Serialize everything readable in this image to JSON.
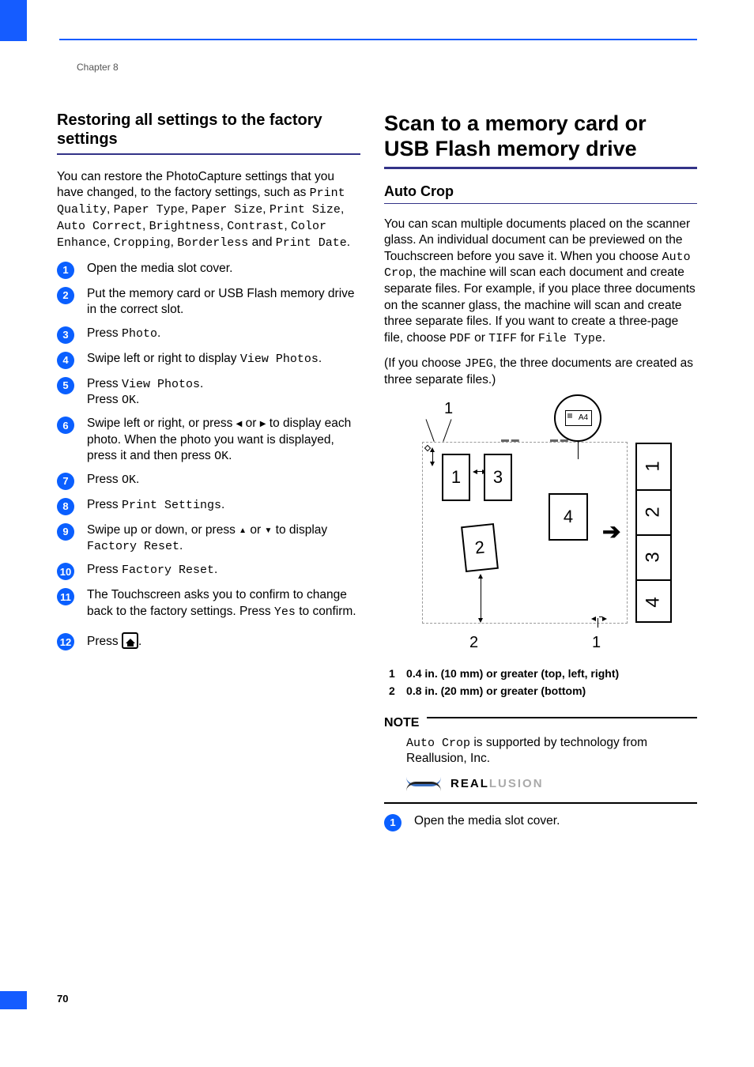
{
  "chapter": "Chapter 8",
  "page_number": "70",
  "left": {
    "heading": "Restoring all settings to the factory settings",
    "intro1": "You can restore the PhotoCapture settings that you have changed, to the factory settings, such as ",
    "mono_settings": [
      "Print Quality",
      "Paper Type",
      "Paper Size",
      "Print Size",
      "Auto Correct",
      "Brightness",
      "Contrast",
      "Color Enhance",
      "Cropping",
      "Borderless"
    ],
    "intro_and": " and ",
    "mono_last": "Print Date",
    "intro_period": ".",
    "steps": [
      {
        "n": "1",
        "body": "Open the media slot cover."
      },
      {
        "n": "2",
        "body": "Put the memory card or USB Flash memory drive in the correct slot."
      },
      {
        "n": "3",
        "pre": "Press ",
        "mono": "Photo",
        "post": "."
      },
      {
        "n": "4",
        "pre": "Swipe left or right to display ",
        "mono": "View Photos",
        "post": "."
      },
      {
        "n": "5",
        "line1_pre": "Press ",
        "line1_mono": "View Photos",
        "line1_post": ".",
        "line2_pre": "Press ",
        "line2_mono": "OK",
        "line2_post": "."
      },
      {
        "n": "6",
        "pre": "Swipe left or right, or press ",
        "mid": " or ",
        "post": " to display each photo. When the photo you want is displayed, press it and then press ",
        "mono": "OK",
        "post2": "."
      },
      {
        "n": "7",
        "pre": "Press ",
        "mono": "OK",
        "post": "."
      },
      {
        "n": "8",
        "pre": "Press ",
        "mono": "Print Settings",
        "post": "."
      },
      {
        "n": "9",
        "pre": "Swipe up or down, or press ",
        "mid": " or ",
        "post": " to display ",
        "mono": "Factory Reset",
        "post2": "."
      },
      {
        "n": "10",
        "pre": "Press ",
        "mono": "Factory Reset",
        "post": "."
      },
      {
        "n": "11",
        "pre": "The Touchscreen asks you to confirm to change back to the factory settings. Press ",
        "mono": "Yes",
        "post": " to confirm."
      },
      {
        "n": "12",
        "pre": "Press ",
        "post": "."
      }
    ]
  },
  "right": {
    "heading": "Scan to a memory card or USB Flash memory drive",
    "sub_heading": "Auto Crop",
    "intro_a": "You can scan multiple documents placed on the scanner glass. An individual document can be previewed on the Touchscreen before you save it. When you choose ",
    "mono_a": "Auto Crop",
    "intro_b": ", the machine will scan each document and create separate files. For example, if you place three documents on the scanner glass, the machine will scan and create three separate files. If you want to create a three-page file, choose ",
    "mono_b": "PDF",
    "intro_c": " or ",
    "mono_c": "TIFF",
    "intro_d": " for ",
    "mono_d": "File Type",
    "intro_e": ".",
    "paren_a": "(If you choose ",
    "mono_jpeg": "JPEG",
    "paren_b": ", the three documents are created as three separate files.)",
    "diagram": {
      "top_label": "1",
      "doc1": "1",
      "doc2": "2",
      "doc3": "3",
      "doc4": "4",
      "bottom_label_left": "2",
      "bottom_label_right": "1",
      "out1": "1",
      "out2": "2",
      "out3": "3",
      "out4": "4",
      "mag_text": "A4"
    },
    "margins": {
      "m1_n": "1",
      "m1": "0.4 in. (10 mm) or greater (top, left, right)",
      "m2_n": "2",
      "m2": "0.8 in. (20 mm) or greater (bottom)"
    },
    "note_label": "NOTE",
    "note_mono": "Auto Crop",
    "note_text": " is supported by technology from Reallusion, Inc.",
    "reallusion_a": "REAL",
    "reallusion_b": "LUSION",
    "step1_n": "1",
    "step1": "Open the media slot cover."
  }
}
